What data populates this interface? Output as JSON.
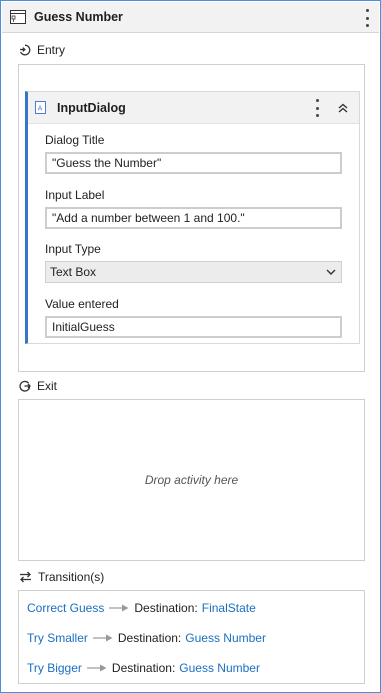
{
  "state": {
    "title": "Guess Number"
  },
  "entry": {
    "label": "Entry",
    "activity": {
      "title": "InputDialog",
      "fields": {
        "dialog_title_label": "Dialog Title",
        "dialog_title_value": "\"Guess the Number\"",
        "input_label_label": "Input Label",
        "input_label_value": "\"Add a number between 1 and 100.\"",
        "input_type_label": "Input Type",
        "input_type_value": "Text Box",
        "value_entered_label": "Value entered",
        "value_entered_value": "InitialGuess"
      }
    }
  },
  "exit": {
    "label": "Exit",
    "drop_text": "Drop activity here"
  },
  "transitions": {
    "label": "Transition(s)",
    "destination_label": "Destination:",
    "items": [
      {
        "name": "Correct Guess",
        "destination": "FinalState"
      },
      {
        "name": "Try Smaller",
        "destination": "Guess Number"
      },
      {
        "name": "Try Bigger",
        "destination": "Guess Number"
      }
    ]
  },
  "colors": {
    "accent": "#3b73c8",
    "link": "#1a6fc2",
    "border": "#4a90d9"
  },
  "icons": {
    "state": "state-icon",
    "entry": "entry-icon",
    "exit": "exit-icon",
    "transitions": "transitions-icon",
    "activity": "input-dialog-icon",
    "more": "kebab-menu-icon",
    "collapse": "chevron-up-double-icon",
    "dropdown": "chevron-down-icon",
    "arrow": "arrow-right-icon"
  }
}
